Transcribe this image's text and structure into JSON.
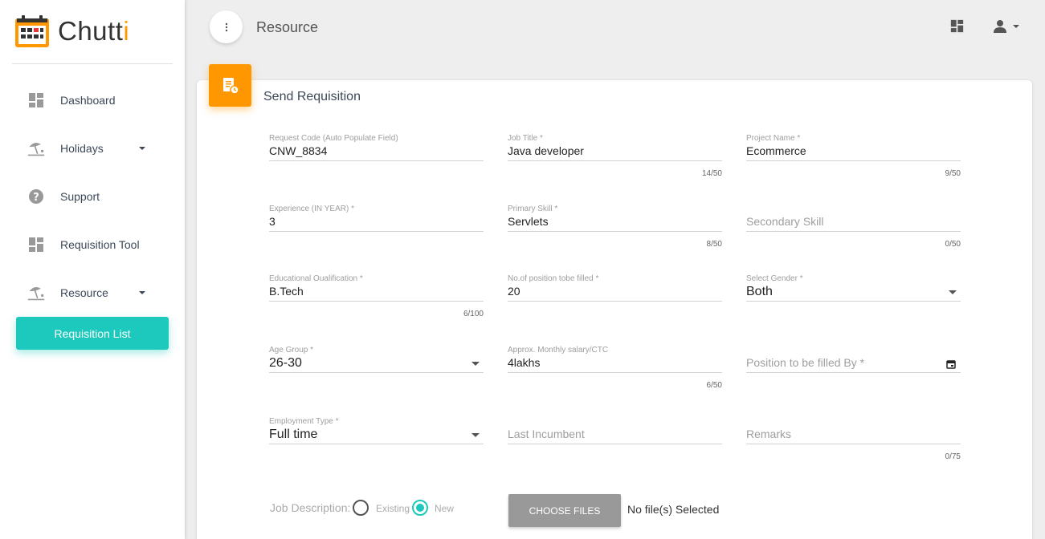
{
  "app": {
    "name_main": "Chutt",
    "name_accent": "i"
  },
  "sidebar": {
    "items": [
      {
        "label": "Dashboard",
        "icon": "dashboard-icon"
      },
      {
        "label": "Holidays",
        "icon": "beach-icon",
        "has_caret": true
      },
      {
        "label": "Support",
        "icon": "help-icon"
      },
      {
        "label": "Requisition Tool",
        "icon": "dashboard-icon"
      },
      {
        "label": "Resource",
        "icon": "beach-icon",
        "has_caret": true
      }
    ],
    "active_sub": "Requisition List"
  },
  "header": {
    "title": "Resource"
  },
  "card": {
    "title": "Send Requisition"
  },
  "form": {
    "request_code": {
      "label": "Request Code (Auto Populate Field)",
      "value": "CNW_8834"
    },
    "job_title": {
      "label": "Job Title *",
      "value": "Java developer",
      "count": "14/50"
    },
    "project_name": {
      "label": "Project Name *",
      "value": "Ecommerce",
      "count": "9/50"
    },
    "experience": {
      "label": "Experience (IN YEAR) *",
      "value": "3"
    },
    "primary_skill": {
      "label": "Primary Skill *",
      "value": "Servlets",
      "count": "8/50"
    },
    "secondary_skill": {
      "placeholder": "Secondary Skill",
      "count": "0/50"
    },
    "qualification": {
      "label": "Educational Oualification *",
      "value": "B.Tech",
      "count": "6/100"
    },
    "positions": {
      "label": "No.of position tobe filled *",
      "value": "20"
    },
    "gender": {
      "label": "Select Gender *",
      "value": "Both"
    },
    "age_group": {
      "label": "Age Group *",
      "value": "26-30"
    },
    "salary": {
      "label": "Approx. Monthly salary/CTC",
      "value": "4lakhs",
      "count": "6/50"
    },
    "filled_by": {
      "placeholder": "Position to be filled By *"
    },
    "employment_type": {
      "label": "Employment Type *",
      "value": "Full time"
    },
    "last_incumbent": {
      "placeholder": "Last Incumbent"
    },
    "remarks": {
      "placeholder": "Remarks",
      "count": "0/75"
    },
    "job_description": {
      "label": "Job Description:",
      "options": [
        "Existing",
        "New"
      ],
      "selected": "New"
    },
    "file": {
      "button": "CHOOSE FILES",
      "status": "No file(s) Selected"
    }
  },
  "colors": {
    "accent": "#1dc9bc",
    "brand": "#ff9800"
  }
}
